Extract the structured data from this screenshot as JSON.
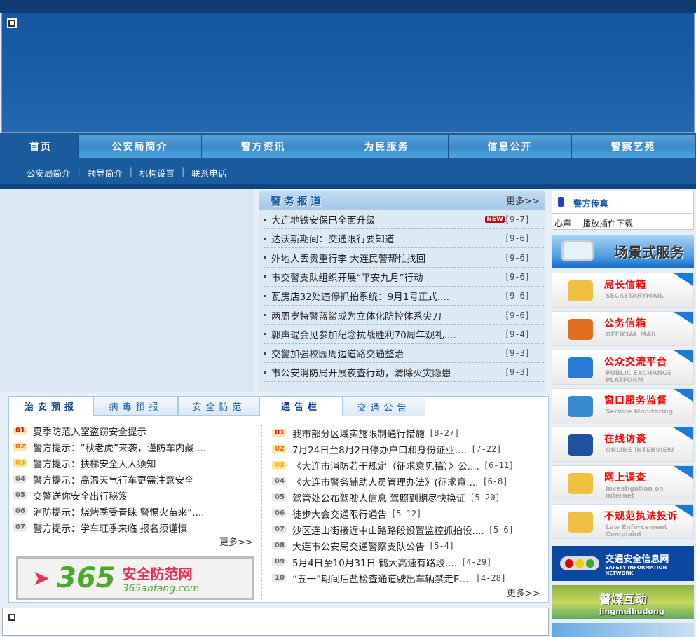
{
  "nav": {
    "items": [
      "首页",
      "公安局简介",
      "警方资讯",
      "为民服务",
      "信息公开",
      "警察艺苑"
    ],
    "sub": [
      "公安局简介",
      "领导简介",
      "机构设置",
      "联系电话"
    ]
  },
  "news": {
    "title": "警务报道",
    "more": "更多>>",
    "new_badge": "NEW",
    "items": [
      {
        "t": "大连地铁安保已全面升级",
        "d": "[9-7]"
      },
      {
        "t": "达沃斯期间：交通限行要知道",
        "d": "[9-6]"
      },
      {
        "t": "外地人丢贵重行李 大连民警帮忙找回",
        "d": "[9-6]"
      },
      {
        "t": "市交警支队组织开展“平安九月”行动",
        "d": "[9-6]"
      },
      {
        "t": "瓦房店32处违停抓拍系统：9月1号正式....",
        "d": "[9-6]"
      },
      {
        "t": "两周岁特警蓝鲨成为立体化防控体系尖刀",
        "d": "[9-6]"
      },
      {
        "t": "郭声琨会见参加纪念抗战胜利70周年观礼....",
        "d": "[9-4]"
      },
      {
        "t": "交警加强校园周边道路交通整治",
        "d": "[9-3]"
      },
      {
        "t": "市公安消防局开展夜查行动，清除火灾隐患",
        "d": "[9-3]"
      }
    ]
  },
  "safety": {
    "tabs": [
      "治安预报",
      "病毒预报",
      "安全防范"
    ],
    "more": "更多>>",
    "items": [
      {
        "n": "01",
        "t": "夏季防范入室盗窃安全提示"
      },
      {
        "n": "02",
        "t": "警方提示：“秋老虎”来袭，谨防车内藏...."
      },
      {
        "n": "03",
        "t": "警方提示：扶梯安全人人须知"
      },
      {
        "n": "04",
        "t": "警方提示：高温天气行车更需注意安全"
      },
      {
        "n": "05",
        "t": "交警送你安全出行秘笈"
      },
      {
        "n": "06",
        "t": "消防提示：烧烤季受青睐 警惕火苗来“...."
      },
      {
        "n": "07",
        "t": "警方提示：学车旺季来临 报名须谨慎"
      }
    ],
    "ad": {
      "logo": "365",
      "cn": "安全防范网",
      "en": "365anfang.com"
    }
  },
  "notice": {
    "tabs": [
      "通告栏",
      "交通公告"
    ],
    "more": "更多>>",
    "items": [
      {
        "n": "01",
        "t": "我市部分区域实施限制通行措施",
        "d": "[8-27]"
      },
      {
        "n": "02",
        "t": "7月24日至8月2日停办户口和身份证业....",
        "d": "[7-22]"
      },
      {
        "n": "03",
        "t": "《大连市消防若干规定（征求意见稿）》公....",
        "d": "[6-11]"
      },
      {
        "n": "04",
        "t": "《大连市警务辅助人员管理办法》(征求意....",
        "d": "[6-8]"
      },
      {
        "n": "05",
        "t": "驾管处公布驾驶人信息 驾照到期尽快换证",
        "d": "[5-20]"
      },
      {
        "n": "06",
        "t": "徒步大会交通限行通告",
        "d": "[5-12]"
      },
      {
        "n": "07",
        "t": "沙区连山街接近中山路路段设置监控抓拍设....",
        "d": "[5-6]"
      },
      {
        "n": "08",
        "t": "大连市公安局交通警察支队公告",
        "d": "[5-4]"
      },
      {
        "n": "09",
        "t": "5月4日至10月31日 鹤大高速有路段....",
        "d": "[4-29]"
      },
      {
        "n": "10",
        "t": "“五一”期间后盐检查通道驶出车辆禁走E....",
        "d": "[4-28]"
      }
    ]
  },
  "right": {
    "fax_title": "警方传真",
    "fax_links": [
      "心声",
      "播放插件下载"
    ],
    "scene": "场景式服务",
    "services": [
      {
        "cn": "局长信箱",
        "en": "SECRETARYMAIL",
        "color": "#f0c040"
      },
      {
        "cn": "公务信箱",
        "en": "OFFICIAL MAIL",
        "color": "#e07020"
      },
      {
        "cn": "公众交流平台",
        "en": "PUBLIC EXCHANGE PLATFORM",
        "color": "#2a7ad8"
      },
      {
        "cn": "窗口服务监督",
        "en": "Service  Monitoring",
        "color": "#3a8ad0"
      },
      {
        "cn": "在线访谈",
        "en": "ONLINE INTERVIEW",
        "color": "#2050a0"
      },
      {
        "cn": "网上调查",
        "en": "Investigation on internet",
        "color": "#f0c040"
      },
      {
        "cn": "不规范执法投诉",
        "en": "Law Enforcement Complaint",
        "color": "#f0c040"
      }
    ],
    "traffic": {
      "cn": "交通安全信息网",
      "en": "SAFETY INFORMATION NETWORK"
    },
    "media": {
      "cn": "警媒互动",
      "en": "jingmeihudong"
    }
  }
}
